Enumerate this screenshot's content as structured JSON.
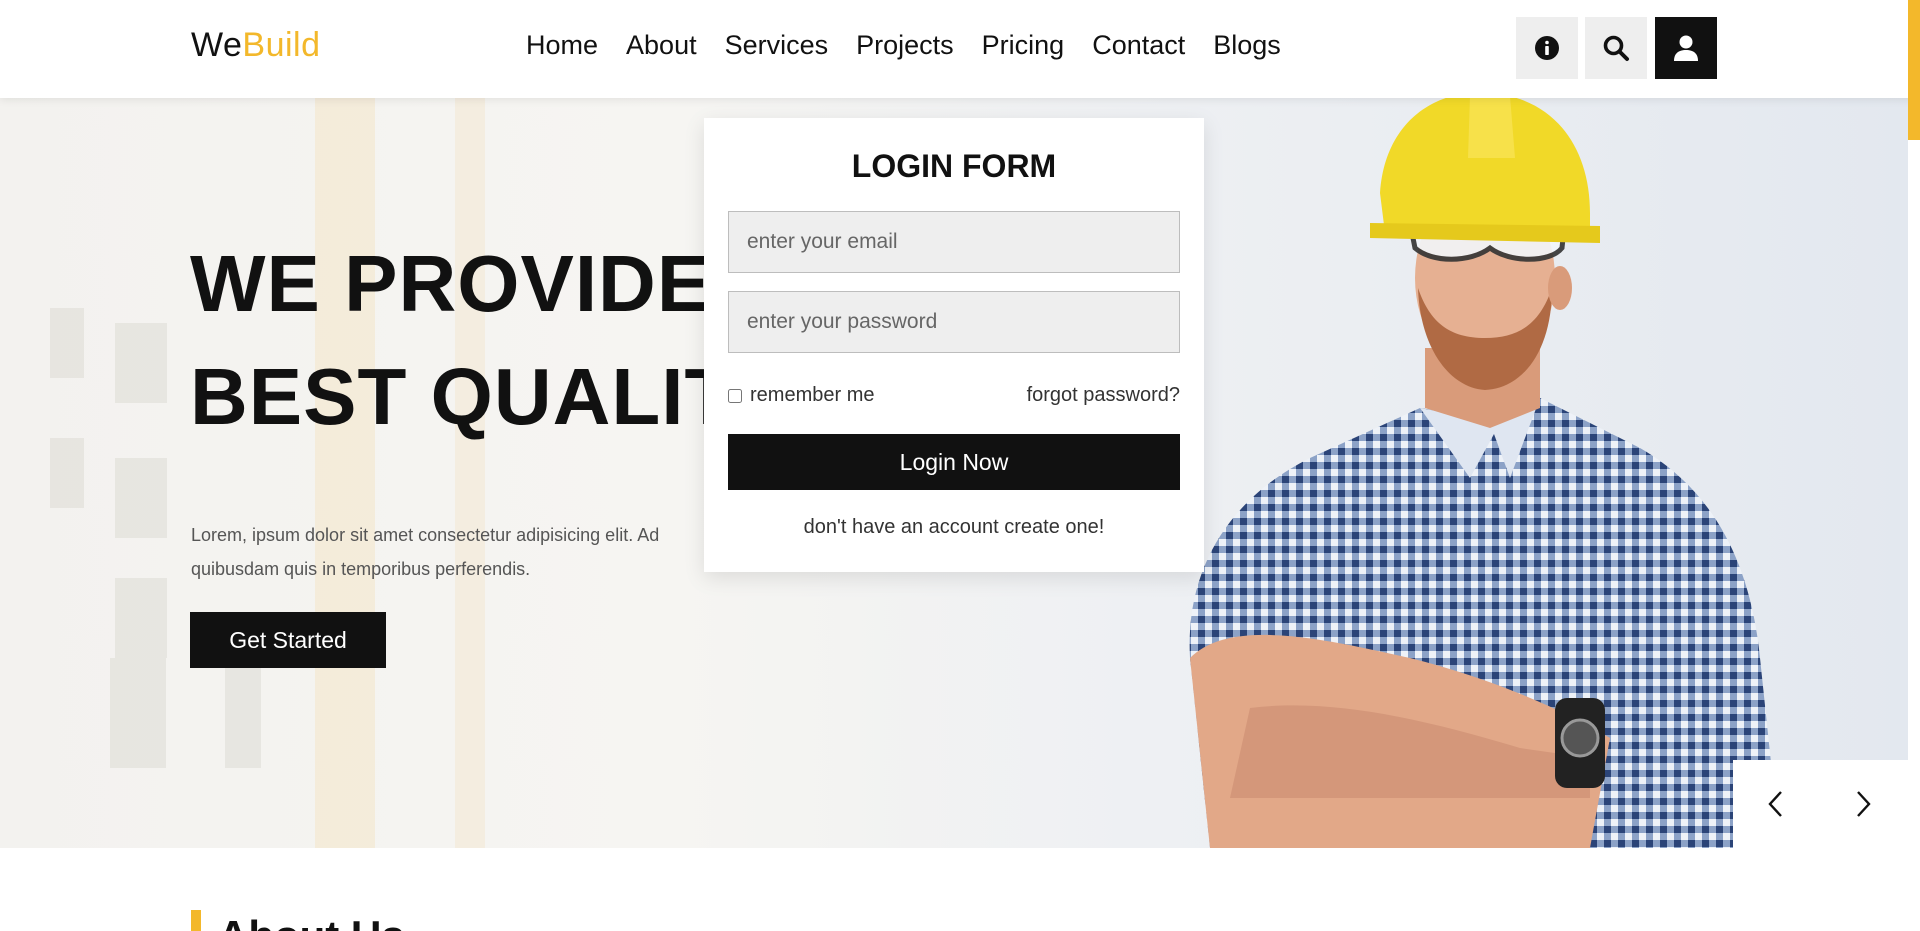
{
  "brand": {
    "part1": "We",
    "part2": "Build"
  },
  "nav": [
    "Home",
    "About",
    "Services",
    "Projects",
    "Pricing",
    "Contact",
    "Blogs"
  ],
  "header_icons": [
    "info-icon",
    "search-icon",
    "user-icon"
  ],
  "hero": {
    "line1": "WE PROVIDE",
    "line2": "BEST QUALITY",
    "text": "Lorem, ipsum dolor sit amet consectetur adipisicing elit. Ad quibusdam quis in temporibus perferendis.",
    "cta": "Get Started"
  },
  "login": {
    "title": "LOGIN FORM",
    "email_placeholder": "enter your email",
    "password_placeholder": "enter your password",
    "remember": "remember me",
    "forgot": "forgot password?",
    "button": "Login Now",
    "create": "don't have an account create one!"
  },
  "slider": {
    "prev": "‹",
    "next": "›"
  },
  "about": {
    "title": "About Us"
  },
  "colors": {
    "accent": "#f3b82b",
    "dark": "#111111",
    "field": "#eeeeee"
  }
}
